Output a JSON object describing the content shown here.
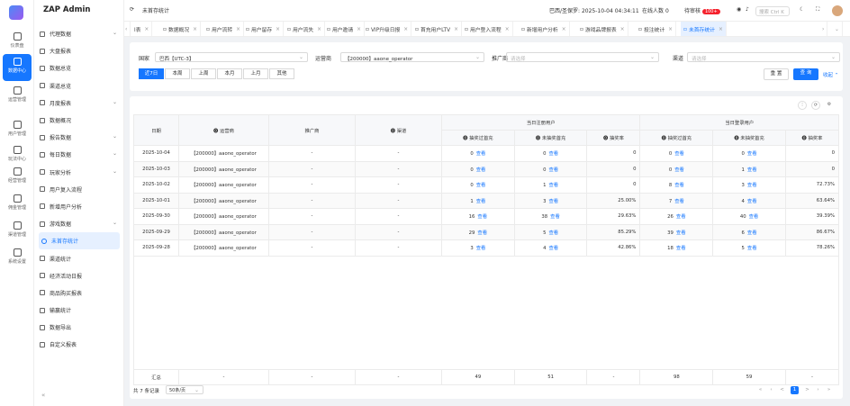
{
  "rail": [
    {
      "label": "仪表盘",
      "icon": "dashboard-icon"
    },
    {
      "label": "数据中心",
      "icon": "database-icon"
    },
    {
      "label": "运营管理",
      "icon": "operations-icon"
    },
    {
      "label": "用户管理",
      "icon": "user-icon"
    },
    {
      "label": "玩法中心",
      "icon": "gamepad-icon"
    },
    {
      "label": "经营管理",
      "icon": "globe-icon"
    },
    {
      "label": "佣金管理",
      "icon": "commission-icon"
    },
    {
      "label": "渠道管理",
      "icon": "channel-icon"
    },
    {
      "label": "系统设置",
      "icon": "settings-icon"
    }
  ],
  "brand": "ZAP Admin",
  "menu": [
    {
      "label": "代理数据",
      "chev": "⌄"
    },
    {
      "label": "大盘报表",
      "chev": ""
    },
    {
      "label": "数据总览",
      "chev": ""
    },
    {
      "label": "渠道总览",
      "chev": ""
    },
    {
      "label": "月度报表",
      "chev": "⌄"
    },
    {
      "label": "数据概况",
      "chev": ""
    },
    {
      "label": "报告数据",
      "chev": "⌄"
    },
    {
      "label": "每日数据",
      "chev": "⌄"
    },
    {
      "label": "玩家分析",
      "chev": "⌄"
    },
    {
      "label": "用户复入流程",
      "chev": ""
    },
    {
      "label": "新增用户分析",
      "chev": ""
    },
    {
      "label": "游戏数据",
      "chev": "⌄"
    },
    {
      "label": "未首存统计",
      "chev": "",
      "active": true
    },
    {
      "label": "渠道统计",
      "chev": ""
    },
    {
      "label": "经济活动日报",
      "chev": ""
    },
    {
      "label": "商品购买报表",
      "chev": ""
    },
    {
      "label": "输赢统计",
      "chev": ""
    },
    {
      "label": "数据导出",
      "chev": ""
    },
    {
      "label": "自定义报表",
      "chev": ""
    }
  ],
  "collapse_icon": "«",
  "topbar": {
    "refresh": "⟳",
    "page_title": "未首存统计",
    "datetime": "巴西/圣保罗: 2025-10-04 04:34:11",
    "online": "在线人数",
    "online_count": "0",
    "pending": "待审核",
    "pending_count": "100+",
    "search_placeholder": "搜索 Ctrl K"
  },
  "tabs": [
    {
      "label": "l表"
    },
    {
      "label": "数据概况"
    },
    {
      "label": "用户流转"
    },
    {
      "label": "用户留存"
    },
    {
      "label": "用户流失"
    },
    {
      "label": "用户邀请"
    },
    {
      "label": "VIP升级日报"
    },
    {
      "label": "首充用户LTV"
    },
    {
      "label": "用户登入流程"
    },
    {
      "label": "新增用户分析"
    },
    {
      "label": "游戏品牌报表"
    },
    {
      "label": "投注统计"
    },
    {
      "label": "未首存统计",
      "active": true
    }
  ],
  "filters": {
    "country_label": "国家",
    "country_value": "巴西【UTC-3】",
    "operator_label": "运营商",
    "operator_value": "【200000】aaone_operator",
    "promoter_label": "推广商",
    "promoter_placeholder": "请选择",
    "channel_label": "渠道",
    "channel_placeholder": "请选择",
    "date_buttons": [
      "近7日",
      "本周",
      "上周",
      "本月",
      "上月",
      "其他"
    ],
    "reset": "重 置",
    "query": "查 询",
    "collapse": "收起"
  },
  "table": {
    "headers": {
      "date": "日期",
      "operator": "运营商",
      "promoter": "推广商",
      "channel": "渠道",
      "reg_group": "当日注册用户",
      "login_group": "当日登录用户",
      "tried": "⓿ 抽奖过首充",
      "not_tried": "⓿ 未抽奖首充",
      "rate": "⓿ 抽奖率"
    },
    "view_label": "查看",
    "rows": [
      {
        "date": "2025-10-04",
        "operator": "【200000】aaone_operator",
        "promoter": "-",
        "channel": "-",
        "r_tried": "0",
        "r_not": "0",
        "r_rate": "0",
        "l_tried": "0",
        "l_not": "0",
        "l_rate": "0"
      },
      {
        "date": "2025-10-03",
        "operator": "【200000】aaone_operator",
        "promoter": "-",
        "channel": "-",
        "r_tried": "0",
        "r_not": "0",
        "r_rate": "0",
        "l_tried": "0",
        "l_not": "1",
        "l_rate": "0"
      },
      {
        "date": "2025-10-02",
        "operator": "【200000】aaone_operator",
        "promoter": "-",
        "channel": "-",
        "r_tried": "0",
        "r_not": "1",
        "r_rate": "0",
        "l_tried": "8",
        "l_not": "3",
        "l_rate": "72.73%"
      },
      {
        "date": "2025-10-01",
        "operator": "【200000】aaone_operator",
        "promoter": "-",
        "channel": "-",
        "r_tried": "1",
        "r_not": "3",
        "r_rate": "25.00%",
        "l_tried": "7",
        "l_not": "4",
        "l_rate": "63.64%"
      },
      {
        "date": "2025-09-30",
        "operator": "【200000】aaone_operator",
        "promoter": "-",
        "channel": "-",
        "r_tried": "16",
        "r_not": "38",
        "r_rate": "29.63%",
        "l_tried": "26",
        "l_not": "40",
        "l_rate": "39.39%"
      },
      {
        "date": "2025-09-29",
        "operator": "【200000】aaone_operator",
        "promoter": "-",
        "channel": "-",
        "r_tried": "29",
        "r_not": "5",
        "r_rate": "85.29%",
        "l_tried": "39",
        "l_not": "6",
        "l_rate": "86.67%"
      },
      {
        "date": "2025-09-28",
        "operator": "【200000】aaone_operator",
        "promoter": "-",
        "channel": "-",
        "r_tried": "3",
        "r_not": "4",
        "r_rate": "42.86%",
        "l_tried": "18",
        "l_not": "5",
        "l_rate": "78.26%"
      }
    ],
    "summary": {
      "label": "汇总",
      "operator": "-",
      "promoter": "-",
      "channel": "-",
      "r_tried": "49",
      "r_not": "51",
      "r_rate": "-",
      "l_tried": "98",
      "l_not": "59",
      "l_rate": "-"
    }
  },
  "footer": {
    "total": "共 7 条记录",
    "page_size": "50条/页",
    "page": "1"
  }
}
